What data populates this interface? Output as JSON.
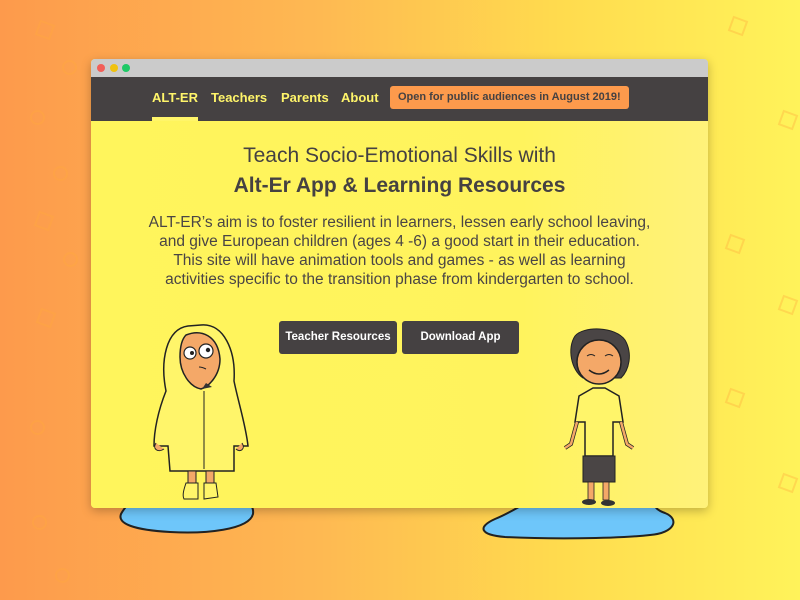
{
  "window": {
    "controls": [
      "close",
      "minimize",
      "maximize"
    ]
  },
  "nav": {
    "items": [
      {
        "label": "ALT-ER",
        "active": true
      },
      {
        "label": "Teachers",
        "active": false
      },
      {
        "label": "Parents",
        "active": false
      },
      {
        "label": "About",
        "active": false
      }
    ],
    "badge": "Open for public audiences in August 2019!"
  },
  "hero": {
    "title_line1": "Teach Socio-Emotional Skills with",
    "title_line2": "Alt-Er App & Learning Resources",
    "description": "ALT-ER’s aim is to foster resilient in learners, lessen early school leaving, and give European children (ages 4 -6) a good start in their education. This site will have animation tools and games - as well as learning activities specific to the transition phase from kindergarten to school.",
    "buttons": {
      "teacher_resources": "Teacher Resources",
      "download_app": "Download App"
    }
  },
  "illustrations": {
    "left": "child-in-raincoat",
    "right": "smiling-boy"
  },
  "colors": {
    "accent_yellow": "#fff55c",
    "nav_dark": "#454142",
    "badge_orange": "#fd9a4c",
    "puddle_blue": "#6ec6fa"
  }
}
